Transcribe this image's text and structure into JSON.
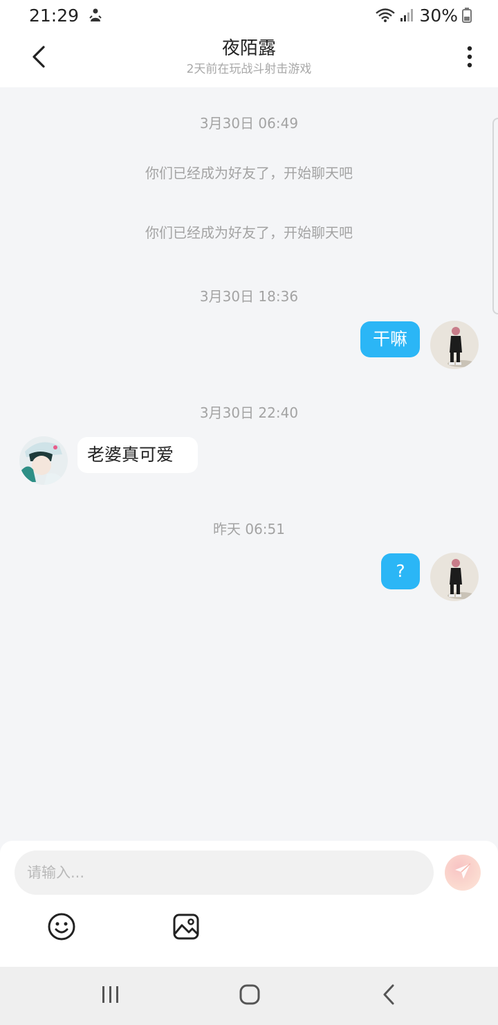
{
  "status_bar": {
    "time": "21:29",
    "battery": "30%",
    "icons": [
      "notification-icon",
      "wifi-icon",
      "signal-icon",
      "battery-icon"
    ]
  },
  "header": {
    "title": "夜陌露",
    "subtitle": "2天前在玩战斗射击游戏",
    "icons": [
      "back-arrow-icon",
      "more-vertical-icon"
    ]
  },
  "chat": {
    "time_1": "3月30日 06:49",
    "system_1": "你们已经成为好友了，开始聊天吧",
    "system_2": "你们已经成为好友了，开始聊天吧",
    "time_2": "3月30日 18:36",
    "msg_out_1": "干嘛",
    "time_3": "3月30日 22:40",
    "msg_in_1": "老婆真可爱",
    "time_4": "昨天 06:51",
    "msg_out_2": "?"
  },
  "composer": {
    "placeholder": "请输入...",
    "icons": [
      "send-icon",
      "emoji-icon",
      "image-icon"
    ]
  },
  "colors": {
    "accent": "#2bb6f6",
    "background": "#f4f5f7",
    "muted_text": "#a3a3a3"
  }
}
